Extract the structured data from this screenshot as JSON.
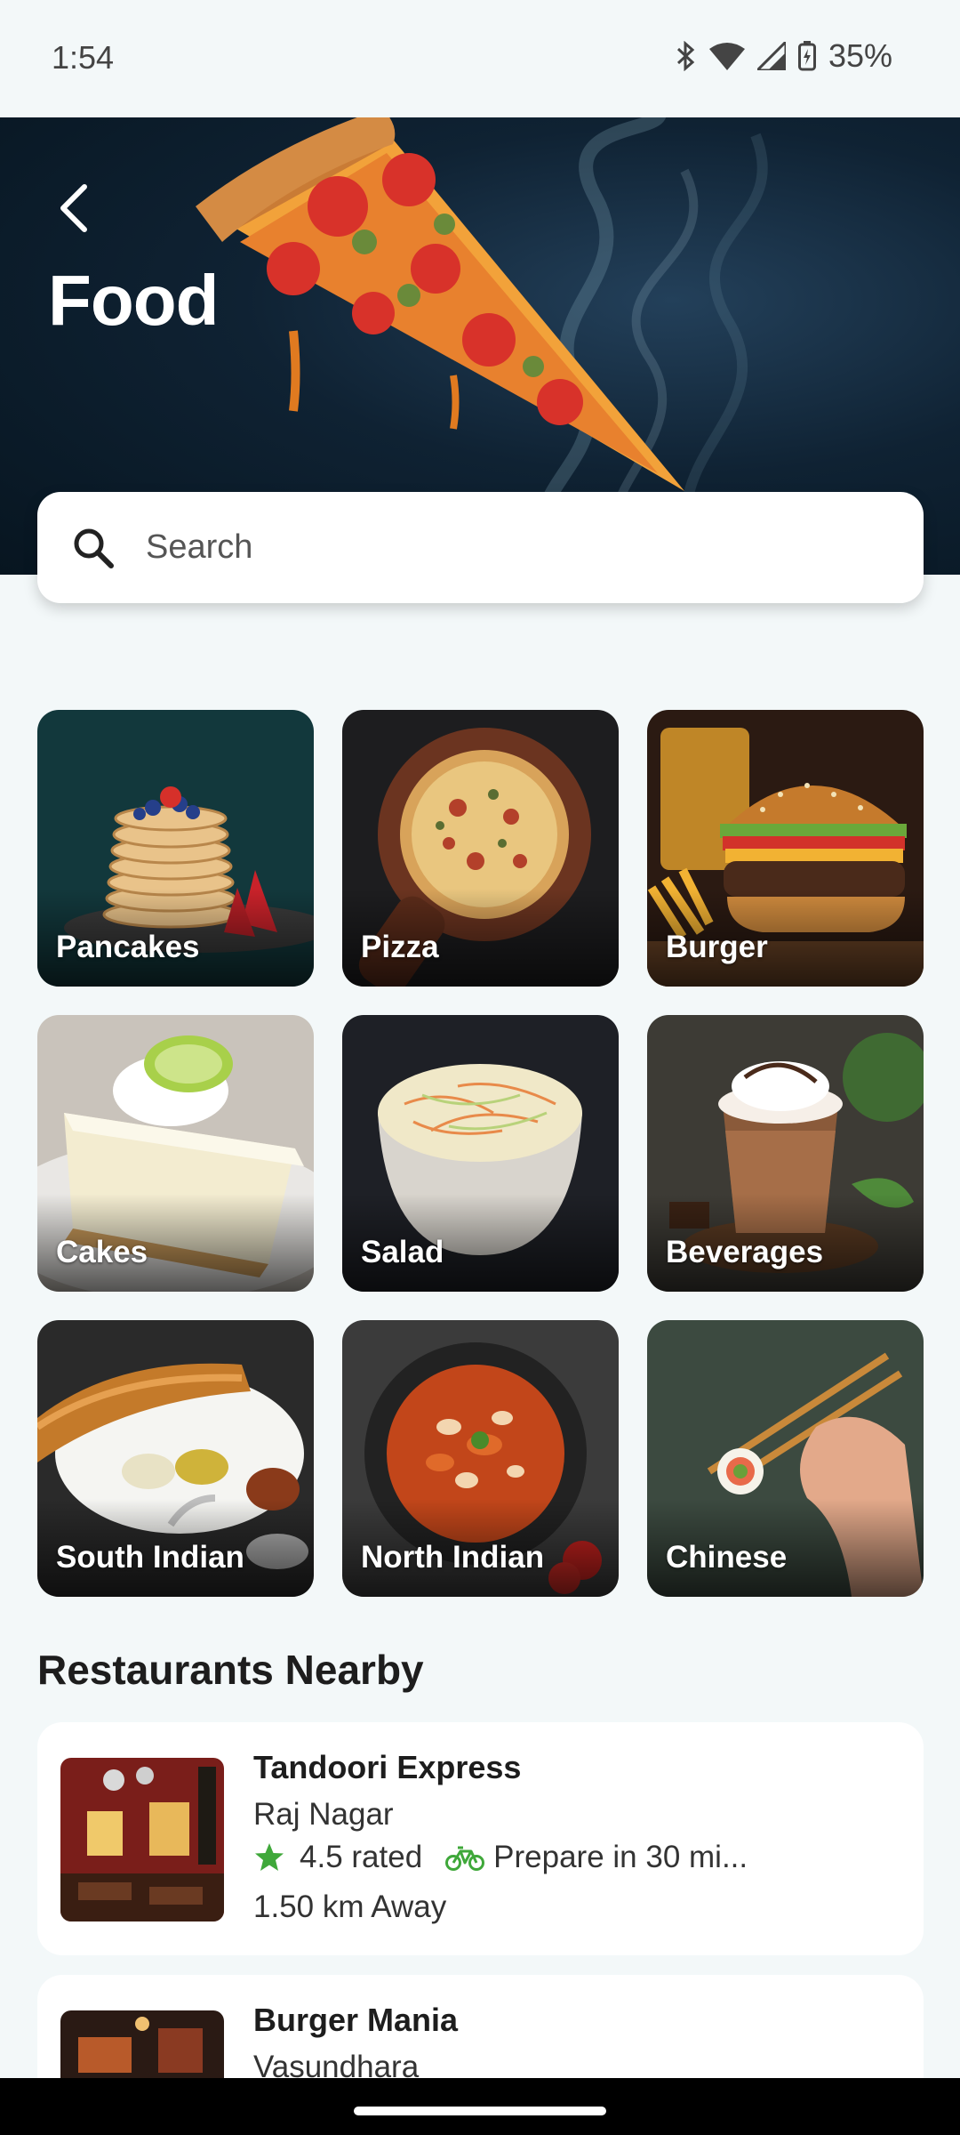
{
  "status_bar": {
    "time": "1:54",
    "battery": "35%",
    "icons": [
      "bluetooth-icon",
      "wifi-icon",
      "signal-icon",
      "battery-charging-icon"
    ]
  },
  "header": {
    "title": "Food",
    "back_icon": "chevron-left-icon"
  },
  "search": {
    "placeholder": "Search",
    "icon": "search-icon"
  },
  "categories": [
    {
      "label": "Pancakes"
    },
    {
      "label": "Pizza"
    },
    {
      "label": "Burger"
    },
    {
      "label": "Cakes"
    },
    {
      "label": "Salad"
    },
    {
      "label": "Beverages"
    },
    {
      "label": "South Indian"
    },
    {
      "label": "North Indian"
    },
    {
      "label": "Chinese"
    }
  ],
  "nearby": {
    "title": "Restaurants Nearby",
    "restaurants": [
      {
        "name": "Tandoori Express",
        "area": "Raj Nagar",
        "rating": "4.5 rated",
        "prep": "Prepare in 30 mi...",
        "distance": "1.50 km Away"
      },
      {
        "name": "Burger Mania",
        "area": "Vasundhara"
      }
    ]
  },
  "colors": {
    "accent_green": "#3fa83a",
    "background": "#f3f8f9",
    "hero_dark": "#0f2233"
  }
}
